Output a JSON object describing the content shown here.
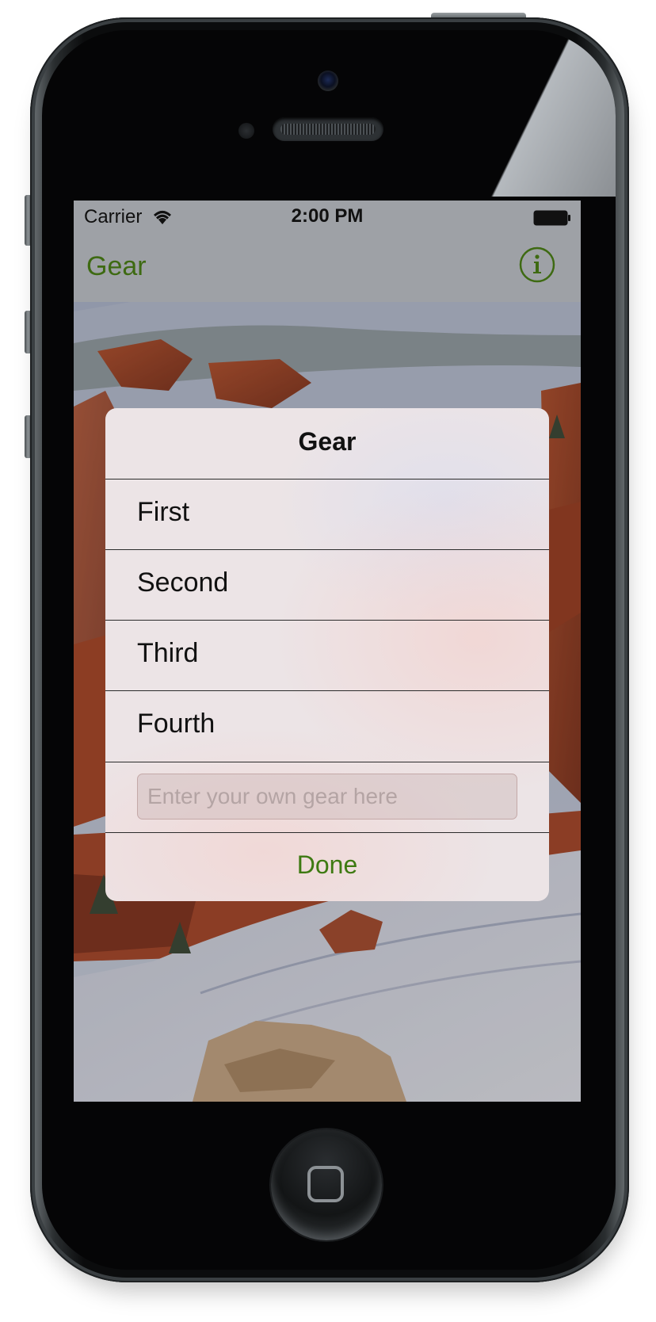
{
  "status_bar": {
    "carrier": "Carrier",
    "time": "2:00 PM",
    "wifi_icon": "wifi-icon",
    "battery_icon": "battery-icon"
  },
  "nav": {
    "title": "Gear",
    "info_icon": "info-icon",
    "tint": "#3e6a12"
  },
  "alert": {
    "title": "Gear",
    "options": [
      {
        "label": "First"
      },
      {
        "label": "Second"
      },
      {
        "label": "Third"
      },
      {
        "label": "Fourth"
      }
    ],
    "input_placeholder": "Enter your own gear here",
    "input_value": "",
    "done_label": "Done",
    "accent": "#3e7a12"
  },
  "device": {
    "home_button_icon": "home-button-icon"
  }
}
